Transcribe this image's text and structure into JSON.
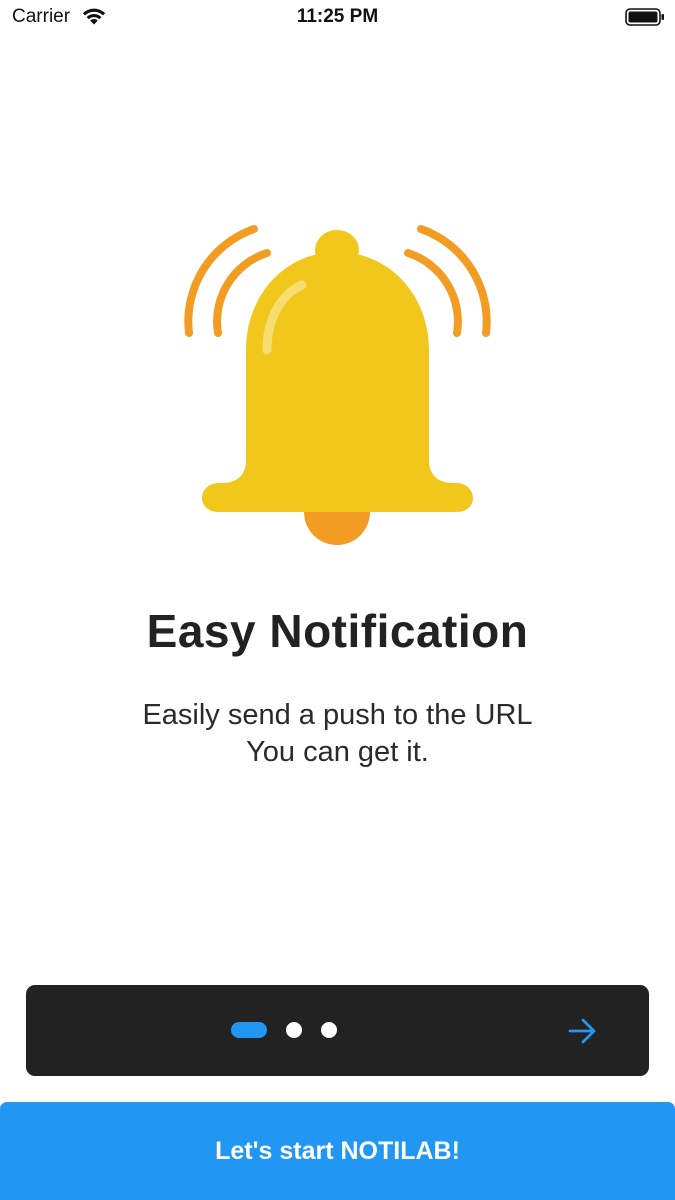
{
  "status_bar": {
    "carrier": "Carrier",
    "time": "11:25 PM",
    "icons": [
      "wifi-icon",
      "battery-icon"
    ]
  },
  "onboarding": {
    "illustration": "bell-icon",
    "title": "Easy Notification",
    "subtitle_lines": [
      "Easily send a push to the URL",
      "You can get it."
    ]
  },
  "pager": {
    "page_count": 3,
    "current_page": 1,
    "next_icon": "arrow-right-icon"
  },
  "cta": {
    "label": "Let's start NOTILAB!"
  },
  "colors": {
    "accent": "#2196f3",
    "bell_body": "#f2c71b",
    "bell_clapper": "#f39c24",
    "pager_background": "#222222",
    "text": "#222222"
  }
}
